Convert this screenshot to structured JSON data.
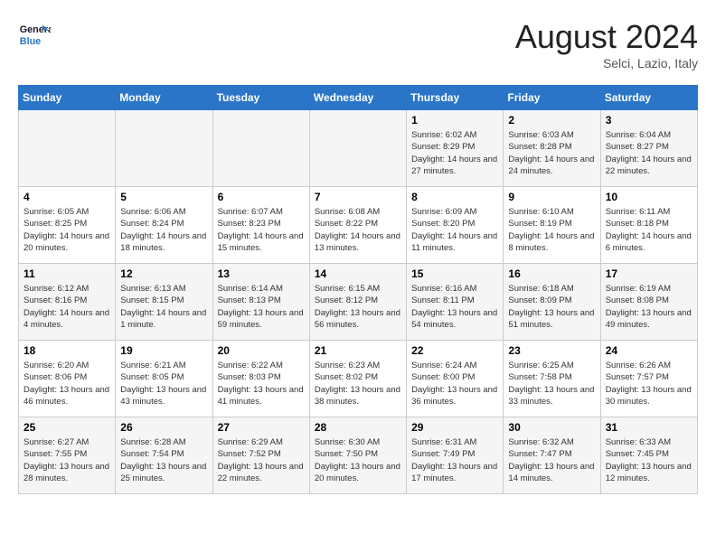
{
  "header": {
    "logo_line1": "General",
    "logo_line2": "Blue",
    "month": "August 2024",
    "location": "Selci, Lazio, Italy"
  },
  "weekdays": [
    "Sunday",
    "Monday",
    "Tuesday",
    "Wednesday",
    "Thursday",
    "Friday",
    "Saturday"
  ],
  "weeks": [
    [
      {
        "day": "",
        "info": ""
      },
      {
        "day": "",
        "info": ""
      },
      {
        "day": "",
        "info": ""
      },
      {
        "day": "",
        "info": ""
      },
      {
        "day": "1",
        "info": "Sunrise: 6:02 AM\nSunset: 8:29 PM\nDaylight: 14 hours and 27 minutes."
      },
      {
        "day": "2",
        "info": "Sunrise: 6:03 AM\nSunset: 8:28 PM\nDaylight: 14 hours and 24 minutes."
      },
      {
        "day": "3",
        "info": "Sunrise: 6:04 AM\nSunset: 8:27 PM\nDaylight: 14 hours and 22 minutes."
      }
    ],
    [
      {
        "day": "4",
        "info": "Sunrise: 6:05 AM\nSunset: 8:25 PM\nDaylight: 14 hours and 20 minutes."
      },
      {
        "day": "5",
        "info": "Sunrise: 6:06 AM\nSunset: 8:24 PM\nDaylight: 14 hours and 18 minutes."
      },
      {
        "day": "6",
        "info": "Sunrise: 6:07 AM\nSunset: 8:23 PM\nDaylight: 14 hours and 15 minutes."
      },
      {
        "day": "7",
        "info": "Sunrise: 6:08 AM\nSunset: 8:22 PM\nDaylight: 14 hours and 13 minutes."
      },
      {
        "day": "8",
        "info": "Sunrise: 6:09 AM\nSunset: 8:20 PM\nDaylight: 14 hours and 11 minutes."
      },
      {
        "day": "9",
        "info": "Sunrise: 6:10 AM\nSunset: 8:19 PM\nDaylight: 14 hours and 8 minutes."
      },
      {
        "day": "10",
        "info": "Sunrise: 6:11 AM\nSunset: 8:18 PM\nDaylight: 14 hours and 6 minutes."
      }
    ],
    [
      {
        "day": "11",
        "info": "Sunrise: 6:12 AM\nSunset: 8:16 PM\nDaylight: 14 hours and 4 minutes."
      },
      {
        "day": "12",
        "info": "Sunrise: 6:13 AM\nSunset: 8:15 PM\nDaylight: 14 hours and 1 minute."
      },
      {
        "day": "13",
        "info": "Sunrise: 6:14 AM\nSunset: 8:13 PM\nDaylight: 13 hours and 59 minutes."
      },
      {
        "day": "14",
        "info": "Sunrise: 6:15 AM\nSunset: 8:12 PM\nDaylight: 13 hours and 56 minutes."
      },
      {
        "day": "15",
        "info": "Sunrise: 6:16 AM\nSunset: 8:11 PM\nDaylight: 13 hours and 54 minutes."
      },
      {
        "day": "16",
        "info": "Sunrise: 6:18 AM\nSunset: 8:09 PM\nDaylight: 13 hours and 51 minutes."
      },
      {
        "day": "17",
        "info": "Sunrise: 6:19 AM\nSunset: 8:08 PM\nDaylight: 13 hours and 49 minutes."
      }
    ],
    [
      {
        "day": "18",
        "info": "Sunrise: 6:20 AM\nSunset: 8:06 PM\nDaylight: 13 hours and 46 minutes."
      },
      {
        "day": "19",
        "info": "Sunrise: 6:21 AM\nSunset: 8:05 PM\nDaylight: 13 hours and 43 minutes."
      },
      {
        "day": "20",
        "info": "Sunrise: 6:22 AM\nSunset: 8:03 PM\nDaylight: 13 hours and 41 minutes."
      },
      {
        "day": "21",
        "info": "Sunrise: 6:23 AM\nSunset: 8:02 PM\nDaylight: 13 hours and 38 minutes."
      },
      {
        "day": "22",
        "info": "Sunrise: 6:24 AM\nSunset: 8:00 PM\nDaylight: 13 hours and 36 minutes."
      },
      {
        "day": "23",
        "info": "Sunrise: 6:25 AM\nSunset: 7:58 PM\nDaylight: 13 hours and 33 minutes."
      },
      {
        "day": "24",
        "info": "Sunrise: 6:26 AM\nSunset: 7:57 PM\nDaylight: 13 hours and 30 minutes."
      }
    ],
    [
      {
        "day": "25",
        "info": "Sunrise: 6:27 AM\nSunset: 7:55 PM\nDaylight: 13 hours and 28 minutes."
      },
      {
        "day": "26",
        "info": "Sunrise: 6:28 AM\nSunset: 7:54 PM\nDaylight: 13 hours and 25 minutes."
      },
      {
        "day": "27",
        "info": "Sunrise: 6:29 AM\nSunset: 7:52 PM\nDaylight: 13 hours and 22 minutes."
      },
      {
        "day": "28",
        "info": "Sunrise: 6:30 AM\nSunset: 7:50 PM\nDaylight: 13 hours and 20 minutes."
      },
      {
        "day": "29",
        "info": "Sunrise: 6:31 AM\nSunset: 7:49 PM\nDaylight: 13 hours and 17 minutes."
      },
      {
        "day": "30",
        "info": "Sunrise: 6:32 AM\nSunset: 7:47 PM\nDaylight: 13 hours and 14 minutes."
      },
      {
        "day": "31",
        "info": "Sunrise: 6:33 AM\nSunset: 7:45 PM\nDaylight: 13 hours and 12 minutes."
      }
    ]
  ]
}
